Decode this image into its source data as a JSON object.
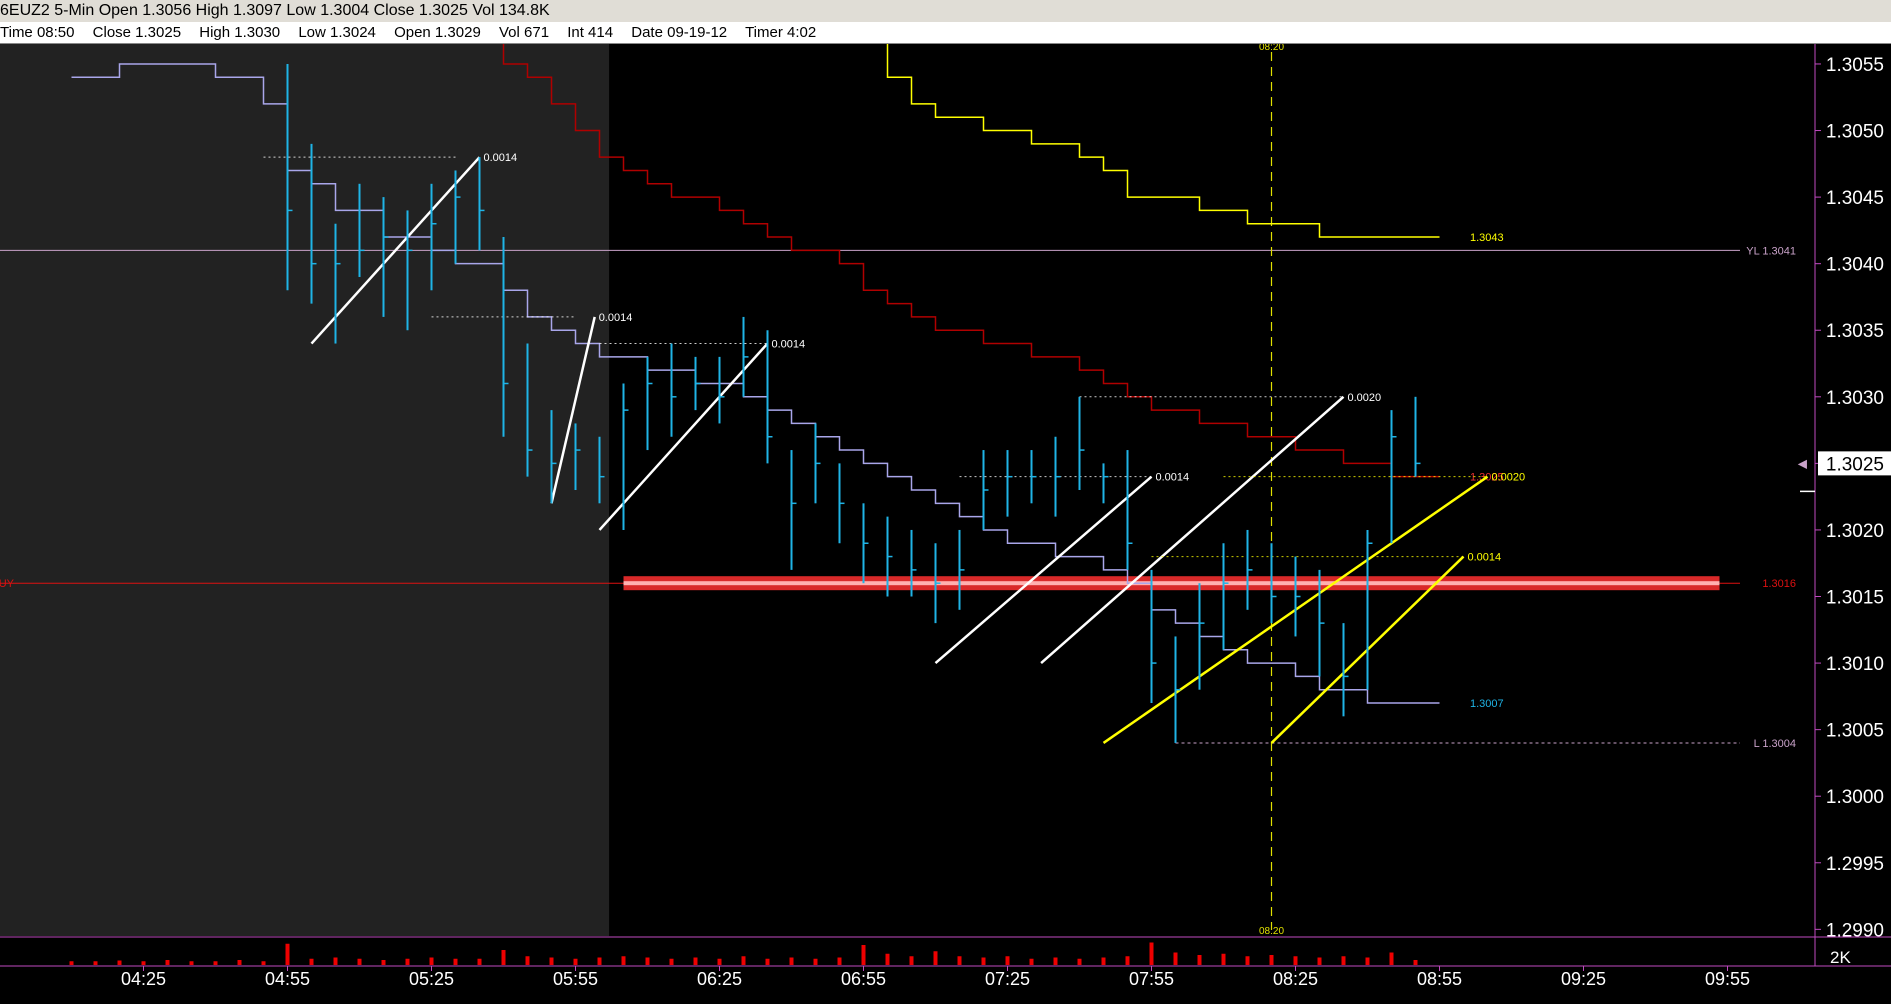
{
  "title_bar": {
    "text": "6EUZ2 5-Min Open 1.3056 High 1.3097 Low 1.3004 Close 1.3025 Vol 134.8K"
  },
  "info_bar": {
    "items": [
      "Time 08:50",
      "Close 1.3025",
      "High 1.3030",
      "Low 1.3024",
      "Open 1.3029",
      "Vol 671",
      "Int 414",
      "Date 09-19-12",
      "Timer 4:02"
    ]
  },
  "colors": {
    "background": "#000000",
    "premarket_shade": "#222222",
    "price_bars": "#1fb4e6",
    "lower_step_line": "#a9a6ea",
    "upper_step_line": "#b00000",
    "yellow_step_line": "#ffff00",
    "pink_line": "#c9a2c9",
    "buy_line": "#dd1111",
    "buy_band": "#ff3030",
    "volume": "#ee0000",
    "axis_text": "#ffffff",
    "axis_line": "#c04ac0"
  },
  "chart_data": {
    "type": "line",
    "title": "6EUZ2 5-Min",
    "y_axis": {
      "ticks": [
        "1.3055",
        "1.3050",
        "1.3045",
        "1.3040",
        "1.3035",
        "1.3030",
        "1.3025",
        "1.3020",
        "1.3015",
        "1.3010",
        "1.3005",
        "1.3000",
        "1.2995",
        "1.2990"
      ],
      "ylim": [
        1.29895,
        1.30565
      ],
      "current_price": "1.3025"
    },
    "x_axis": {
      "ticks": [
        "04:25",
        "04:55",
        "05:25",
        "05:55",
        "06:25",
        "06:55",
        "07:25",
        "07:55",
        "08:25",
        "08:55",
        "09:25",
        "09:55"
      ],
      "start": "04:10",
      "step_minutes": 5
    },
    "bars": [
      {
        "t": "04:55",
        "h": 1.3055,
        "l": 1.3038,
        "c": 1.3044
      },
      {
        "t": "05:00",
        "h": 1.3049,
        "l": 1.3037,
        "c": 1.304
      },
      {
        "t": "05:05",
        "h": 1.3043,
        "l": 1.3034,
        "c": 1.304
      },
      {
        "t": "05:10",
        "h": 1.3046,
        "l": 1.3039,
        "c": 1.3041
      },
      {
        "t": "05:15",
        "h": 1.3045,
        "l": 1.3036,
        "c": 1.3042
      },
      {
        "t": "05:20",
        "h": 1.3044,
        "l": 1.3035,
        "c": 1.3041
      },
      {
        "t": "05:25",
        "h": 1.3046,
        "l": 1.3038,
        "c": 1.3043
      },
      {
        "t": "05:30",
        "h": 1.3047,
        "l": 1.304,
        "c": 1.3045
      },
      {
        "t": "05:35",
        "h": 1.3048,
        "l": 1.3041,
        "c": 1.3044
      },
      {
        "t": "05:40",
        "h": 1.3042,
        "l": 1.3027,
        "c": 1.3031
      },
      {
        "t": "05:45",
        "h": 1.3034,
        "l": 1.3024,
        "c": 1.3026
      },
      {
        "t": "05:50",
        "h": 1.3029,
        "l": 1.3022,
        "c": 1.3025
      },
      {
        "t": "05:55",
        "h": 1.3028,
        "l": 1.3023,
        "c": 1.3026
      },
      {
        "t": "06:00",
        "h": 1.3027,
        "l": 1.3022,
        "c": 1.3024
      },
      {
        "t": "06:05",
        "h": 1.3031,
        "l": 1.302,
        "c": 1.3029
      },
      {
        "t": "06:10",
        "h": 1.3033,
        "l": 1.3026,
        "c": 1.3031
      },
      {
        "t": "06:15",
        "h": 1.3034,
        "l": 1.3027,
        "c": 1.303
      },
      {
        "t": "06:20",
        "h": 1.3033,
        "l": 1.3029,
        "c": 1.3031
      },
      {
        "t": "06:25",
        "h": 1.3033,
        "l": 1.3028,
        "c": 1.303
      },
      {
        "t": "06:30",
        "h": 1.3036,
        "l": 1.303,
        "c": 1.3033
      },
      {
        "t": "06:35",
        "h": 1.3035,
        "l": 1.3025,
        "c": 1.3027
      },
      {
        "t": "06:40",
        "h": 1.3026,
        "l": 1.3017,
        "c": 1.3022
      },
      {
        "t": "06:45",
        "h": 1.3028,
        "l": 1.3022,
        "c": 1.3025
      },
      {
        "t": "06:50",
        "h": 1.3025,
        "l": 1.3019,
        "c": 1.3022
      },
      {
        "t": "06:55",
        "h": 1.3022,
        "l": 1.3016,
        "c": 1.3019
      },
      {
        "t": "07:00",
        "h": 1.3021,
        "l": 1.3015,
        "c": 1.3018
      },
      {
        "t": "07:05",
        "h": 1.302,
        "l": 1.3015,
        "c": 1.3017
      },
      {
        "t": "07:10",
        "h": 1.3019,
        "l": 1.3013,
        "c": 1.3016
      },
      {
        "t": "07:15",
        "h": 1.302,
        "l": 1.3014,
        "c": 1.3017
      },
      {
        "t": "07:20",
        "h": 1.3026,
        "l": 1.302,
        "c": 1.3023
      },
      {
        "t": "07:25",
        "h": 1.3026,
        "l": 1.3021,
        "c": 1.3024
      },
      {
        "t": "07:30",
        "h": 1.3026,
        "l": 1.3022,
        "c": 1.3024
      },
      {
        "t": "07:35",
        "h": 1.3027,
        "l": 1.3021,
        "c": 1.3024
      },
      {
        "t": "07:40",
        "h": 1.303,
        "l": 1.3023,
        "c": 1.3026
      },
      {
        "t": "07:45",
        "h": 1.3025,
        "l": 1.3022,
        "c": 1.3024
      },
      {
        "t": "07:50",
        "h": 1.3026,
        "l": 1.3017,
        "c": 1.3019
      },
      {
        "t": "07:55",
        "h": 1.3017,
        "l": 1.3007,
        "c": 1.301
      },
      {
        "t": "08:00",
        "h": 1.3012,
        "l": 1.3004,
        "c": 1.3008
      },
      {
        "t": "08:05",
        "h": 1.3016,
        "l": 1.3008,
        "c": 1.3013
      },
      {
        "t": "08:10",
        "h": 1.3019,
        "l": 1.3011,
        "c": 1.3016
      },
      {
        "t": "08:15",
        "h": 1.302,
        "l": 1.3014,
        "c": 1.3017
      },
      {
        "t": "08:20",
        "h": 1.3019,
        "l": 1.3013,
        "c": 1.3015
      },
      {
        "t": "08:25",
        "h": 1.3018,
        "l": 1.3012,
        "c": 1.3015
      },
      {
        "t": "08:30",
        "h": 1.3017,
        "l": 1.3009,
        "c": 1.3013
      },
      {
        "t": "08:35",
        "h": 1.3013,
        "l": 1.3006,
        "c": 1.3009
      },
      {
        "t": "08:40",
        "h": 1.302,
        "l": 1.3008,
        "c": 1.3019
      },
      {
        "t": "08:45",
        "h": 1.3029,
        "l": 1.3019,
        "c": 1.3027
      },
      {
        "t": "08:50",
        "h": 1.303,
        "l": 1.3024,
        "c": 1.3025
      }
    ],
    "lower_step_line": {
      "last_label": "1.3007",
      "points": [
        [
          "04:10",
          1.3054
        ],
        [
          "04:20",
          1.3055
        ],
        [
          "04:30",
          1.3055
        ],
        [
          "04:40",
          1.3054
        ],
        [
          "04:50",
          1.3052
        ],
        [
          "04:55",
          1.3047
        ],
        [
          "05:00",
          1.3046
        ],
        [
          "05:05",
          1.3044
        ],
        [
          "05:10",
          1.3044
        ],
        [
          "05:15",
          1.3042
        ],
        [
          "05:20",
          1.3042
        ],
        [
          "05:25",
          1.3041
        ],
        [
          "05:30",
          1.304
        ],
        [
          "05:35",
          1.304
        ],
        [
          "05:40",
          1.3038
        ],
        [
          "05:45",
          1.3036
        ],
        [
          "05:50",
          1.3035
        ],
        [
          "05:55",
          1.3034
        ],
        [
          "06:00",
          1.3033
        ],
        [
          "06:05",
          1.3033
        ],
        [
          "06:10",
          1.3032
        ],
        [
          "06:15",
          1.3032
        ],
        [
          "06:20",
          1.3031
        ],
        [
          "06:25",
          1.3031
        ],
        [
          "06:30",
          1.303
        ],
        [
          "06:35",
          1.3029
        ],
        [
          "06:40",
          1.3028
        ],
        [
          "06:45",
          1.3027
        ],
        [
          "06:50",
          1.3026
        ],
        [
          "06:55",
          1.3025
        ],
        [
          "07:00",
          1.3024
        ],
        [
          "07:05",
          1.3023
        ],
        [
          "07:10",
          1.3022
        ],
        [
          "07:15",
          1.3021
        ],
        [
          "07:20",
          1.302
        ],
        [
          "07:25",
          1.3019
        ],
        [
          "07:30",
          1.3019
        ],
        [
          "07:35",
          1.3018
        ],
        [
          "07:40",
          1.3018
        ],
        [
          "07:45",
          1.3017
        ],
        [
          "07:50",
          1.3016
        ],
        [
          "07:55",
          1.3014
        ],
        [
          "08:00",
          1.3013
        ],
        [
          "08:05",
          1.3012
        ],
        [
          "08:10",
          1.3011
        ],
        [
          "08:15",
          1.301
        ],
        [
          "08:20",
          1.301
        ],
        [
          "08:25",
          1.3009
        ],
        [
          "08:30",
          1.3008
        ],
        [
          "08:35",
          1.3008
        ],
        [
          "08:40",
          1.3007
        ],
        [
          "08:45",
          1.3007
        ],
        [
          "08:55",
          1.3007
        ]
      ]
    },
    "upper_step_line": {
      "last_label": "1.3025",
      "points": [
        [
          "05:35",
          1.3057
        ],
        [
          "05:40",
          1.3055
        ],
        [
          "05:45",
          1.3054
        ],
        [
          "05:50",
          1.3052
        ],
        [
          "05:55",
          1.305
        ],
        [
          "06:00",
          1.3048
        ],
        [
          "06:05",
          1.3047
        ],
        [
          "06:10",
          1.3046
        ],
        [
          "06:15",
          1.3045
        ],
        [
          "06:20",
          1.3045
        ],
        [
          "06:25",
          1.3044
        ],
        [
          "06:30",
          1.3043
        ],
        [
          "06:35",
          1.3042
        ],
        [
          "06:40",
          1.3041
        ],
        [
          "06:45",
          1.3041
        ],
        [
          "06:50",
          1.304
        ],
        [
          "06:55",
          1.3038
        ],
        [
          "07:00",
          1.3037
        ],
        [
          "07:05",
          1.3036
        ],
        [
          "07:10",
          1.3035
        ],
        [
          "07:15",
          1.3035
        ],
        [
          "07:20",
          1.3034
        ],
        [
          "07:25",
          1.3034
        ],
        [
          "07:30",
          1.3033
        ],
        [
          "07:35",
          1.3033
        ],
        [
          "07:40",
          1.3032
        ],
        [
          "07:45",
          1.3031
        ],
        [
          "07:50",
          1.303
        ],
        [
          "07:55",
          1.3029
        ],
        [
          "08:00",
          1.3029
        ],
        [
          "08:05",
          1.3028
        ],
        [
          "08:10",
          1.3028
        ],
        [
          "08:15",
          1.3027
        ],
        [
          "08:20",
          1.3027
        ],
        [
          "08:25",
          1.3026
        ],
        [
          "08:30",
          1.3026
        ],
        [
          "08:35",
          1.3025
        ],
        [
          "08:40",
          1.3025
        ],
        [
          "08:45",
          1.3024
        ],
        [
          "08:55",
          1.3024
        ]
      ]
    },
    "yellow_step_line": {
      "last_label": "1.3043",
      "points": [
        [
          "06:55",
          1.3057
        ],
        [
          "07:00",
          1.3054
        ],
        [
          "07:05",
          1.3052
        ],
        [
          "07:10",
          1.3051
        ],
        [
          "07:15",
          1.3051
        ],
        [
          "07:20",
          1.305
        ],
        [
          "07:25",
          1.305
        ],
        [
          "07:30",
          1.3049
        ],
        [
          "07:35",
          1.3049
        ],
        [
          "07:40",
          1.3048
        ],
        [
          "07:45",
          1.3047
        ],
        [
          "07:50",
          1.3045
        ],
        [
          "07:55",
          1.3045
        ],
        [
          "08:00",
          1.3045
        ],
        [
          "08:05",
          1.3044
        ],
        [
          "08:10",
          1.3044
        ],
        [
          "08:15",
          1.3043
        ],
        [
          "08:20",
          1.3043
        ],
        [
          "08:25",
          1.3043
        ],
        [
          "08:30",
          1.3042
        ],
        [
          "08:35",
          1.3042
        ],
        [
          "08:40",
          1.3042
        ],
        [
          "08:45",
          1.3042
        ],
        [
          "08:55",
          1.3042
        ]
      ]
    },
    "horizontal_lines": [
      {
        "name": "yesterday-low",
        "price": 1.3041,
        "label": "YL 1.3041",
        "color": "#c9a2c9"
      },
      {
        "name": "buy-level",
        "price": 1.3016,
        "label": "1.3016",
        "left_label": "BUY",
        "color": "#dd1111"
      },
      {
        "name": "session-low",
        "price": 1.3004,
        "label": "L 1.3004",
        "color": "#c9a2c9",
        "from": "08:00",
        "dashed": true
      }
    ],
    "buy_band": {
      "price": 1.3016,
      "from": "06:05",
      "to": "09:55"
    },
    "vertical_marker": {
      "time": "08:20",
      "label": "08:20"
    },
    "measure_lines": [
      {
        "from": [
          "05:00",
          1.3034
        ],
        "to": [
          "05:35",
          1.3048
        ],
        "label": "0.0014",
        "color": "#ffffff",
        "ref_from": "04:50",
        "ref_to": "05:30"
      },
      {
        "from": [
          "05:50",
          1.3022
        ],
        "to": [
          "05:59",
          1.3036
        ],
        "label": "0.0014",
        "color": "#ffffff",
        "ref_from": "05:25",
        "ref_to": "05:55"
      },
      {
        "from": [
          "06:00",
          1.302
        ],
        "to": [
          "06:35",
          1.3034
        ],
        "label": "0.0014",
        "color": "#ffffff",
        "ref_from": "06:00",
        "ref_to": "06:35"
      },
      {
        "from": [
          "07:10",
          1.301
        ],
        "to": [
          "07:55",
          1.3024
        ],
        "label": "0.0014",
        "color": "#ffffff",
        "ref_from": "07:15",
        "ref_to": "07:55"
      },
      {
        "from": [
          "07:32",
          1.301
        ],
        "to": [
          "08:35",
          1.303
        ],
        "label": "0.0020",
        "color": "#ffffff",
        "ref_from": "07:40",
        "ref_to": "08:35"
      },
      {
        "from": [
          "07:45",
          1.3004
        ],
        "to": [
          "09:05",
          1.3024
        ],
        "label": "0.0020",
        "color": "#ffff00",
        "ref_from": "08:10",
        "ref_to": "09:05"
      },
      {
        "from": [
          "08:20",
          1.3004
        ],
        "to": [
          "09:00",
          1.3018
        ],
        "label": "0.0014",
        "color": "#ffff00",
        "ref_from": "07:55",
        "ref_to": "09:00"
      }
    ],
    "volume": {
      "axis_label": "2K",
      "values": [
        [
          "04:10",
          0.15
        ],
        [
          "04:15",
          0.15
        ],
        [
          "04:20",
          0.18
        ],
        [
          "04:25",
          0.15
        ],
        [
          "04:30",
          0.2
        ],
        [
          "04:35",
          0.15
        ],
        [
          "04:40",
          0.15
        ],
        [
          "04:45",
          0.2
        ],
        [
          "04:50",
          0.15
        ],
        [
          "04:55",
          0.85
        ],
        [
          "05:00",
          0.25
        ],
        [
          "05:05",
          0.3
        ],
        [
          "05:10",
          0.25
        ],
        [
          "05:15",
          0.2
        ],
        [
          "05:20",
          0.25
        ],
        [
          "05:25",
          0.3
        ],
        [
          "05:30",
          0.25
        ],
        [
          "05:35",
          0.25
        ],
        [
          "05:40",
          0.6
        ],
        [
          "05:45",
          0.35
        ],
        [
          "05:50",
          0.3
        ],
        [
          "05:55",
          0.25
        ],
        [
          "06:00",
          0.3
        ],
        [
          "06:05",
          0.35
        ],
        [
          "06:10",
          0.3
        ],
        [
          "06:15",
          0.25
        ],
        [
          "06:20",
          0.3
        ],
        [
          "06:25",
          0.25
        ],
        [
          "06:30",
          0.35
        ],
        [
          "06:35",
          0.25
        ],
        [
          "06:40",
          0.3
        ],
        [
          "06:45",
          0.25
        ],
        [
          "06:50",
          0.3
        ],
        [
          "06:55",
          0.8
        ],
        [
          "07:00",
          0.45
        ],
        [
          "07:05",
          0.35
        ],
        [
          "07:10",
          0.55
        ],
        [
          "07:15",
          0.35
        ],
        [
          "07:20",
          0.3
        ],
        [
          "07:25",
          0.35
        ],
        [
          "07:30",
          0.25
        ],
        [
          "07:35",
          0.3
        ],
        [
          "07:40",
          0.25
        ],
        [
          "07:45",
          0.3
        ],
        [
          "07:50",
          0.35
        ],
        [
          "07:55",
          0.9
        ],
        [
          "08:00",
          0.5
        ],
        [
          "08:05",
          0.4
        ],
        [
          "08:10",
          0.45
        ],
        [
          "08:15",
          0.35
        ],
        [
          "08:20",
          0.4
        ],
        [
          "08:25",
          0.35
        ],
        [
          "08:30",
          0.3
        ],
        [
          "08:35",
          0.35
        ],
        [
          "08:40",
          0.3
        ],
        [
          "08:45",
          0.5
        ],
        [
          "08:50",
          0.2
        ]
      ]
    },
    "premarket_until": "06:02"
  }
}
